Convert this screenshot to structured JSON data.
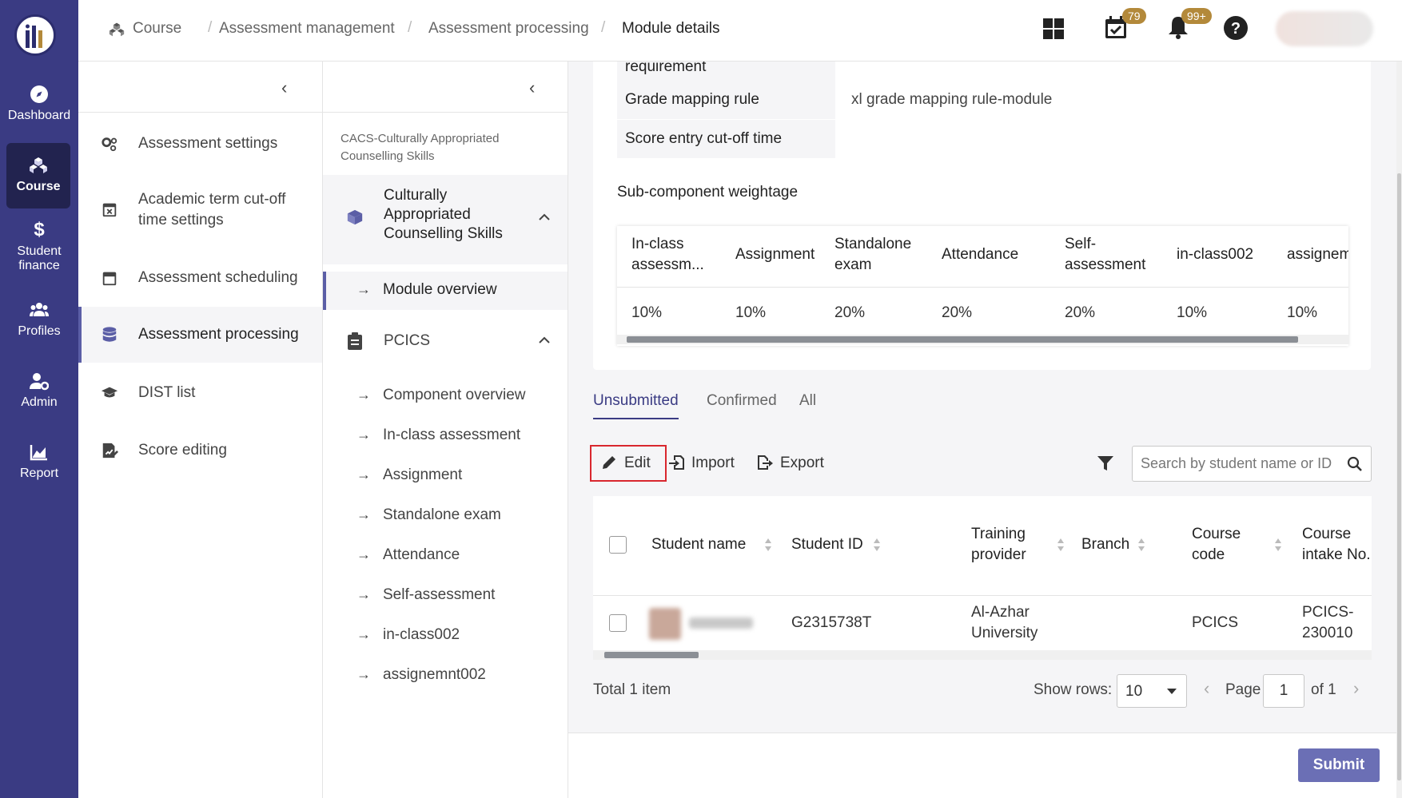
{
  "nav": {
    "items": [
      {
        "label": "Dashboard",
        "icon": "compass-icon"
      },
      {
        "label": "Course",
        "icon": "cubes-icon"
      },
      {
        "label": "Student finance",
        "icon": "dollar-icon"
      },
      {
        "label": "Profiles",
        "icon": "users-icon"
      },
      {
        "label": "Admin",
        "icon": "user-gear-icon"
      },
      {
        "label": "Report",
        "icon": "chart-icon"
      }
    ]
  },
  "header": {
    "breadcrumb": [
      "Course",
      "Assessment management",
      "Assessment processing",
      "Module details"
    ],
    "tasks_badge": "79",
    "notifications_badge": "99+"
  },
  "menu": {
    "items": [
      {
        "label": "Assessment settings"
      },
      {
        "label": "Academic term cut-off time settings"
      },
      {
        "label": "Assessment scheduling"
      },
      {
        "label": "Assessment processing"
      },
      {
        "label": "DIST list"
      },
      {
        "label": "Score editing"
      }
    ]
  },
  "modules": {
    "title": "CACS-Culturally Appropriated Counselling Skills",
    "group1": "Culturally Appropriated Counselling Skills",
    "group1_items": [
      "Module overview"
    ],
    "group2": "PCICS",
    "group2_items": [
      "Component overview",
      "In-class assessment",
      "Assignment",
      "Standalone exam",
      "Attendance",
      "Self-assessment",
      "in-class002",
      "assignemnt002"
    ]
  },
  "details": {
    "partial_label": "requirement",
    "grade_mapping_label": "Grade mapping rule",
    "grade_mapping_value": "xl grade mapping rule-module",
    "cutoff_label": "Score entry cut-off time",
    "subcomponent_title": "Sub-component weightage",
    "weight_headers": [
      "In-class assessm...",
      "Assignment",
      "Standalone exam",
      "Attendance",
      "Self-assessment",
      "in-class002",
      "assignem"
    ],
    "weight_values": [
      "10%",
      "10%",
      "20%",
      "20%",
      "20%",
      "10%",
      "10%"
    ]
  },
  "tabs": [
    "Unsubmitted",
    "Confirmed",
    "All"
  ],
  "toolbar": {
    "edit": "Edit",
    "import": "Import",
    "export": "Export",
    "search_placeholder": "Search by student name or ID"
  },
  "students": {
    "headers": [
      "Student name",
      "Student ID",
      "Training provider",
      "Branch",
      "Course code",
      "Course intake No."
    ],
    "rows": [
      {
        "id": "G2315738T",
        "provider": "Al-Azhar University",
        "branch": "",
        "course_code": "PCICS",
        "intake": "PCICS-230010"
      }
    ]
  },
  "pagination": {
    "total": "Total 1 item",
    "show_rows_label": "Show rows:",
    "rows_value": "10",
    "page_label": "Page",
    "page_value": "1",
    "of_label": "of 1"
  },
  "submit_label": "Submit"
}
